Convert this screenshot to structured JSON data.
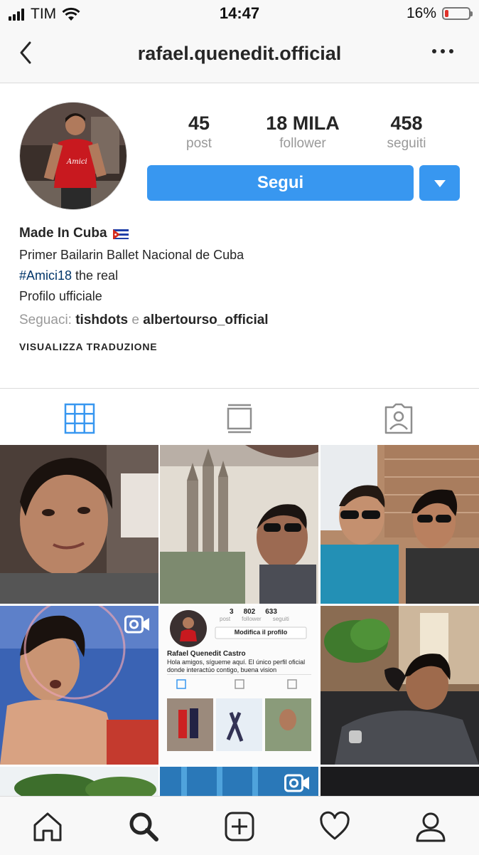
{
  "status_bar": {
    "carrier": "TIM",
    "time": "14:47",
    "battery": "16%",
    "battery_level": 0.16
  },
  "header": {
    "username": "rafael.quenedit.official"
  },
  "profile": {
    "stats": [
      {
        "value": "45",
        "label": "post"
      },
      {
        "value": "18 MILA",
        "label": "follower"
      },
      {
        "value": "458",
        "label": "seguiti"
      }
    ],
    "follow_label": "Segui",
    "name": "Made In Cuba",
    "bio_line1": "Primer Bailarin Ballet Nacional de Cuba",
    "hashtag": "#Amici18",
    "bio_line2_rest": " the real",
    "bio_line3": "Profilo ufficiale",
    "followed_by_label": "Seguaci: ",
    "followed_by_1": "tishdots",
    "followed_by_sep": " e ",
    "followed_by_2": "albertourso_official",
    "translate_label": "VISUALIZZA TRADUZIONE"
  },
  "tabs": [
    {
      "icon": "grid-icon",
      "active": true
    },
    {
      "icon": "feed-icon",
      "active": false
    },
    {
      "icon": "tagged-icon",
      "active": false
    }
  ],
  "grid": {
    "posts": [
      {
        "kind": "photo"
      },
      {
        "kind": "photo"
      },
      {
        "kind": "photo"
      },
      {
        "kind": "video"
      },
      {
        "kind": "screenshot"
      },
      {
        "kind": "photo"
      },
      {
        "kind": "photo"
      },
      {
        "kind": "video"
      },
      {
        "kind": "photo"
      }
    ],
    "inner_screenshot": {
      "stats": [
        "3",
        "802",
        "633"
      ],
      "stat_labels": [
        "post",
        "follower",
        "seguiti"
      ],
      "button": "Modifica il profilo",
      "name": "Rafael Quenedit Castro",
      "bio1": "Hola amigos, sígueme aquí. El único perfil oficial",
      "bio2": "donde interactúo contigo, buena vision"
    }
  },
  "colors": {
    "accent": "#3897f0",
    "hashtag": "#003569",
    "battery_low": "#e0322b"
  },
  "bottom_nav": [
    "home-icon",
    "search-icon",
    "add-icon",
    "heart-icon",
    "profile-icon"
  ]
}
